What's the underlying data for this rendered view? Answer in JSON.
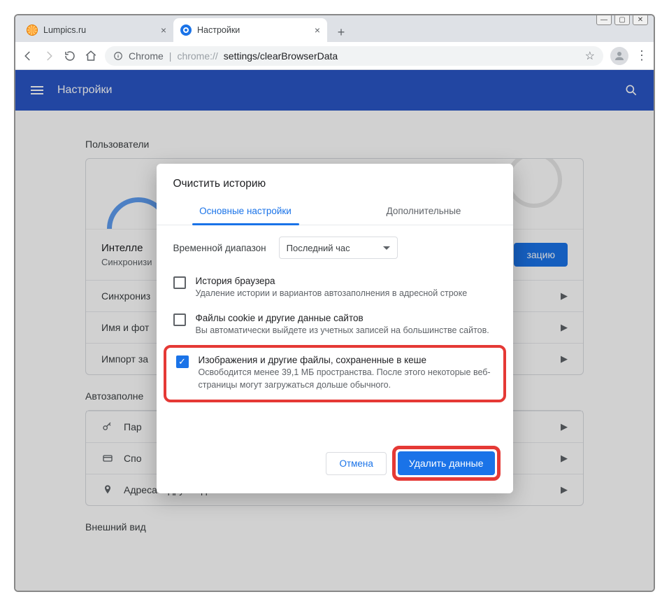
{
  "window": {
    "tabs": [
      {
        "title": "Lumpics.ru"
      },
      {
        "title": "Настройки"
      }
    ],
    "address": {
      "label": "Chrome",
      "host": "chrome://",
      "path": "settings/clearBrowserData"
    }
  },
  "header": {
    "title": "Настройки"
  },
  "sections": {
    "users_title": "Пользователи",
    "intel_title": "Интелле",
    "intel_sub": "Синхронизи",
    "sync_btn": "зацию",
    "rows": {
      "sync": "Синхрониз",
      "name": "Имя и фот",
      "import": "Импорт за"
    },
    "autofill_title": "Автозаполне",
    "autofill_rows": {
      "pass": "Пар",
      "pay": "Спо",
      "addr": "Адреса и другие данные"
    },
    "appearance_title": "Внешний вид"
  },
  "dialog": {
    "title": "Очистить историю",
    "tab_basic": "Основные настройки",
    "tab_advanced": "Дополнительные",
    "range_label": "Временной диапазон",
    "range_value": "Последний час",
    "opt1": {
      "title": "История браузера",
      "sub": "Удаление истории и вариантов автозаполнения в адресной строке"
    },
    "opt2": {
      "title": "Файлы cookie и другие данные сайтов",
      "sub": "Вы автоматически выйдете из учетных записей на большинстве сайтов."
    },
    "opt3": {
      "title": "Изображения и другие файлы, сохраненные в кеше",
      "sub": "Освободится менее 39,1 МБ пространства. После этого некоторые веб-страницы могут загружаться дольше обычного."
    },
    "cancel": "Отмена",
    "confirm": "Удалить данные"
  }
}
